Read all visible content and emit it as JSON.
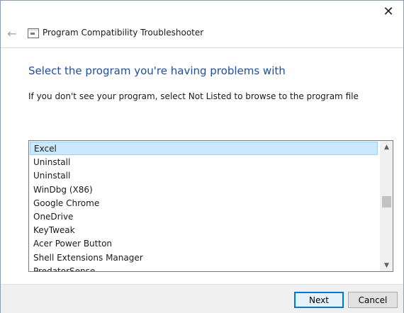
{
  "window": {
    "title": "Program Compatibility Troubleshooter",
    "close_glyph": "✕",
    "back_glyph": "←"
  },
  "content": {
    "heading": "Select the program you're having problems with",
    "instructions": "If you don't see your program, select Not Listed to browse to the program file"
  },
  "program_list": {
    "items": [
      "Excel",
      "Uninstall",
      "Uninstall",
      "WinDbg (X86)",
      "Google Chrome",
      "OneDrive",
      "KeyTweak",
      "Acer Power Button",
      "Shell Extensions Manager",
      "PredatorSense"
    ],
    "selected_index": 0,
    "scroll_up_glyph": "▲",
    "scroll_down_glyph": "▼"
  },
  "footer": {
    "next_label": "Next",
    "cancel_label": "Cancel"
  },
  "colors": {
    "heading": "#1f4ea1",
    "selection_bg": "#cce8ff",
    "selection_border": "#99d1ff",
    "primary_button_border": "#0078d7"
  }
}
